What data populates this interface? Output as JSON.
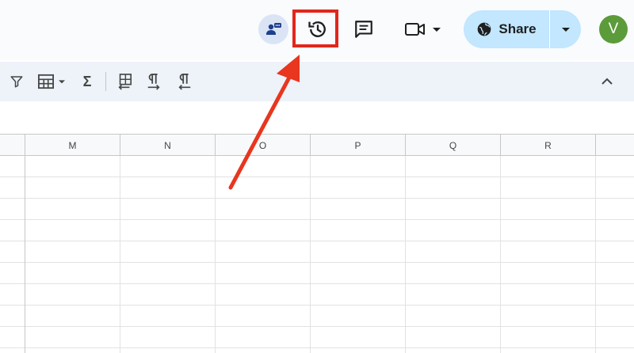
{
  "header": {
    "presence_icon": "person-chat-icon",
    "history_icon": "version-history-icon",
    "comment_icon": "comment-icon",
    "meet_icon": "video-camera-icon",
    "share": {
      "label": "Share",
      "icon": "globe-icon"
    },
    "avatar_letter": "V"
  },
  "toolbar": {
    "items": [
      "filter-icon",
      "table-icon",
      "sigma-icon",
      "freeze-icon",
      "ltr-icon",
      "rtl-icon",
      "collapse-chevron-icon"
    ],
    "sum_symbol": "Σ"
  },
  "grid": {
    "columns": [
      "M",
      "N",
      "O",
      "P",
      "Q",
      "R"
    ]
  },
  "colors": {
    "highlight": "#e2261b",
    "share_bg": "#c2e7ff",
    "avatar_bg": "#5c9b3a"
  }
}
